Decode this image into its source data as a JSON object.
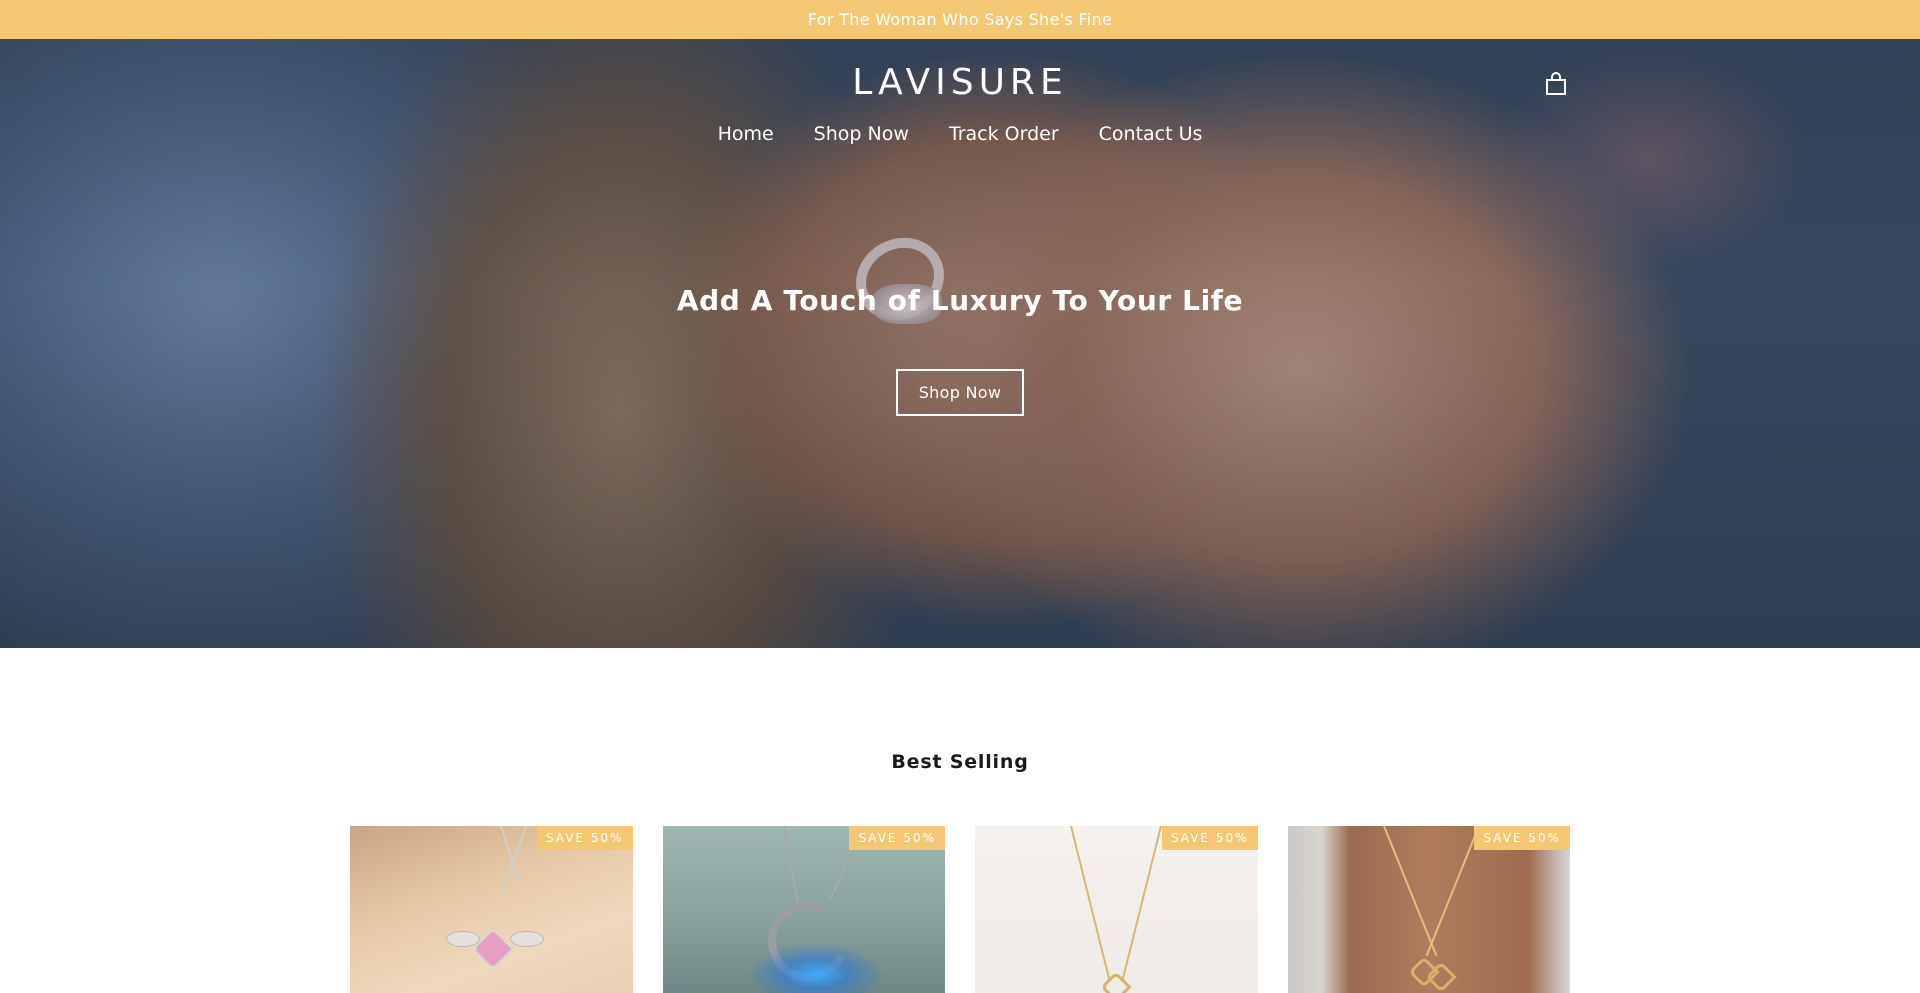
{
  "announcement": {
    "text": "For The Woman Who Says She's Fine"
  },
  "header": {
    "logo": "LAVISURE",
    "cart_icon": "shopping-bag-icon",
    "nav": [
      {
        "label": "Home"
      },
      {
        "label": "Shop Now"
      },
      {
        "label": "Track Order"
      },
      {
        "label": "Contact Us"
      }
    ]
  },
  "hero": {
    "title": "Add A Touch of Luxury To Your Life",
    "button_label": "Shop Now"
  },
  "best_selling": {
    "title": "Best Selling",
    "products": [
      {
        "badge": "SAVE 50%"
      },
      {
        "badge": "SAVE 50%"
      },
      {
        "badge": "SAVE 50%"
      },
      {
        "badge": "SAVE 50%"
      }
    ]
  },
  "colors": {
    "accent": "#f3c774",
    "text": "#1a1a1a",
    "on_hero": "#ffffff"
  }
}
